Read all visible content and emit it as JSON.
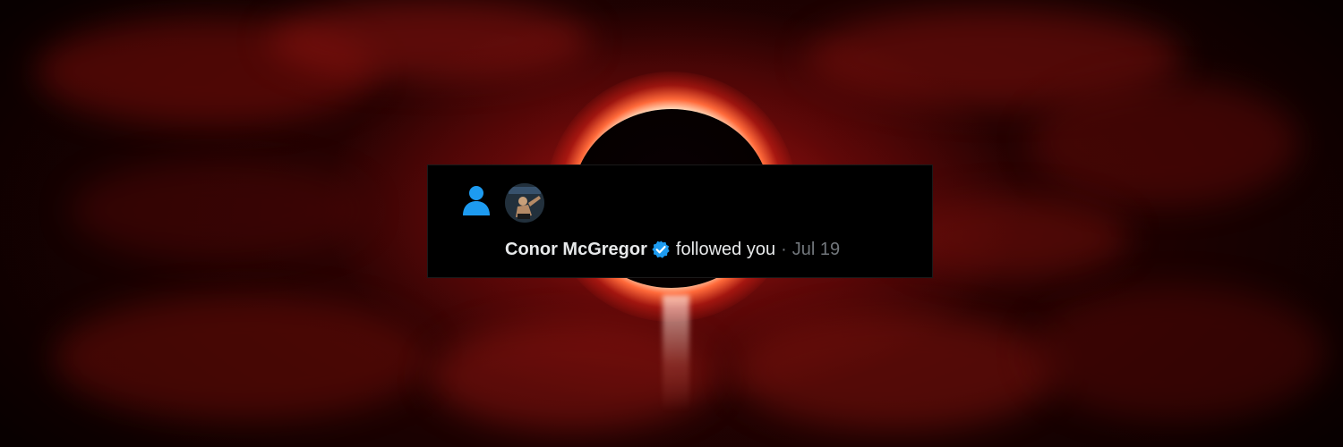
{
  "notification": {
    "user_name": "Conor McGregor",
    "action": "followed you",
    "separator": "·",
    "timestamp": "Jul 19"
  },
  "icons": {
    "notification_type": "person-icon",
    "verified": "verified-badge-icon"
  },
  "colors": {
    "card_background": "#000000",
    "primary_text": "#e7e9ea",
    "secondary_text": "#71767b",
    "accent_blue": "#1d9bf0",
    "banner_red": "#b01a14"
  }
}
